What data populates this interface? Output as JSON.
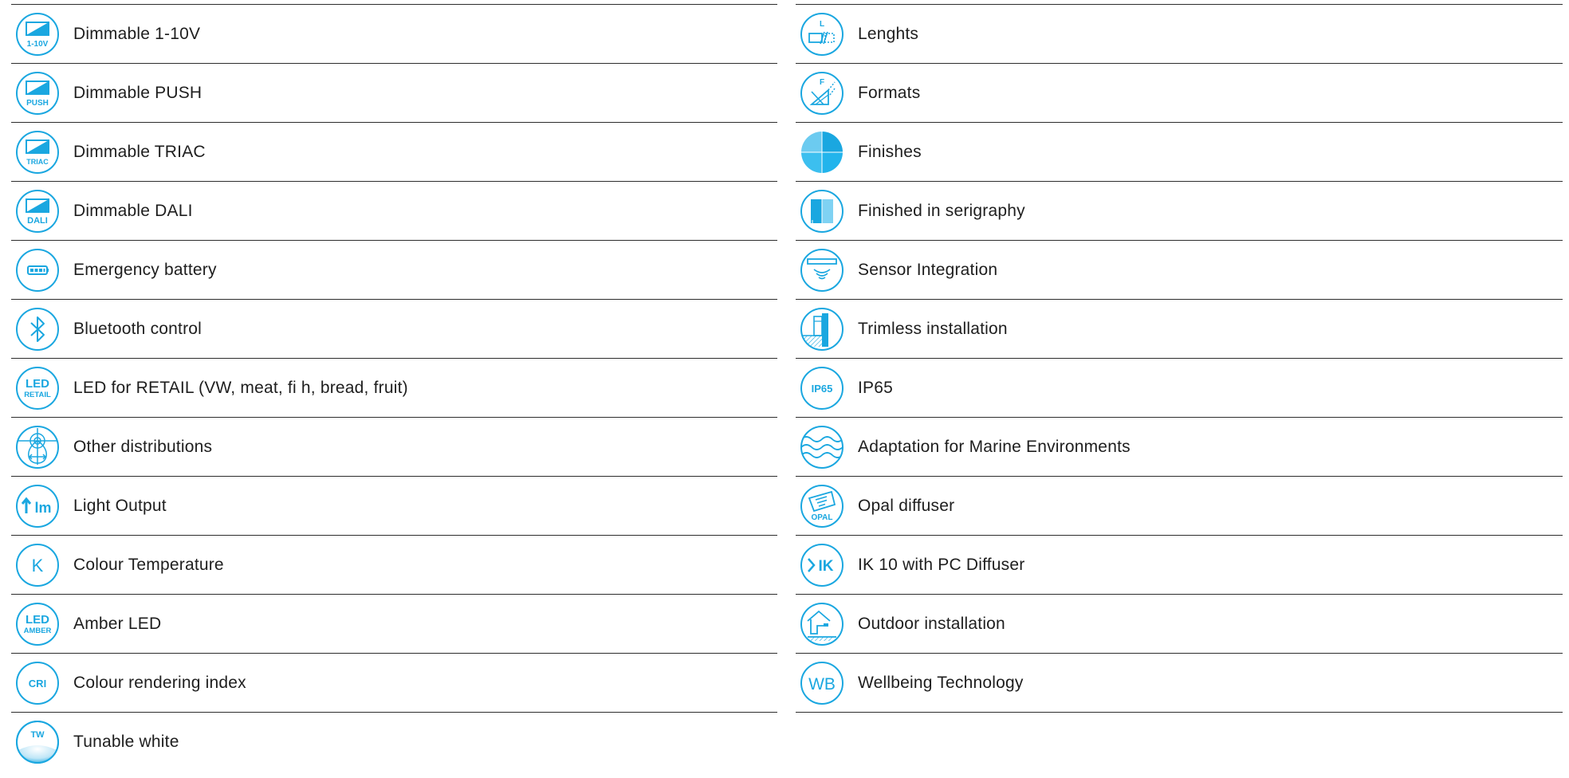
{
  "colors": {
    "accent": "#1aa7e0",
    "rule": "#2c2c2c",
    "text": "#1e1e1e"
  },
  "left": [
    {
      "label": "Dimmable 1-10V",
      "icon": "dimmable-1-10v-icon",
      "icon_text": "1-10V"
    },
    {
      "label": "Dimmable PUSH",
      "icon": "dimmable-push-icon",
      "icon_text": "PUSH"
    },
    {
      "label": "Dimmable TRIAC",
      "icon": "dimmable-triac-icon",
      "icon_text": "TRIAC"
    },
    {
      "label": "Dimmable DALI",
      "icon": "dimmable-dali-icon",
      "icon_text": "DALI"
    },
    {
      "label": "Emergency battery",
      "icon": "battery-icon"
    },
    {
      "label": "Bluetooth control",
      "icon": "bluetooth-icon"
    },
    {
      "label": "LED for RETAIL (VW, meat, fi  h, bread, fruit)",
      "icon": "led-retail-icon",
      "icon_text": "LED",
      "icon_text2": "RETAIL"
    },
    {
      "label": "Other distributions",
      "icon": "distributions-icon"
    },
    {
      "label": "Light Output",
      "icon": "light-output-icon",
      "icon_text": "lm"
    },
    {
      "label": "Colour Temperature",
      "icon": "colour-temperature-icon",
      "icon_text": "K"
    },
    {
      "label": "Amber LED",
      "icon": "amber-led-icon",
      "icon_text": "LED",
      "icon_text2": "AMBER"
    },
    {
      "label": "Colour rendering index",
      "icon": "cri-icon",
      "icon_text": "CRI"
    },
    {
      "label": "Tunable white",
      "icon": "tunable-white-icon",
      "icon_text": "TW"
    }
  ],
  "right": [
    {
      "label": "Lenghts",
      "icon": "lengths-icon",
      "icon_text": "L"
    },
    {
      "label": "Formats",
      "icon": "formats-icon",
      "icon_text": "F"
    },
    {
      "label": "Finishes",
      "icon": "finishes-icon"
    },
    {
      "label": "Finished in serigraphy",
      "icon": "serigraphy-icon"
    },
    {
      "label": "Sensor Integration",
      "icon": "sensor-icon"
    },
    {
      "label": "Trimless installation",
      "icon": "trimless-icon"
    },
    {
      "label": "IP65",
      "icon": "ip65-icon",
      "icon_text": "IP65"
    },
    {
      "label": "Adaptation for Marine Environments",
      "icon": "marine-waves-icon"
    },
    {
      "label": "Opal diffuser",
      "icon": "opal-diffuser-icon",
      "icon_text": "OPAL"
    },
    {
      "label": "IK 10 with PC Diffuser",
      "icon": "ik10-icon",
      "icon_text": "IK"
    },
    {
      "label": "Outdoor installation",
      "icon": "outdoor-icon"
    },
    {
      "label": "Wellbeing Technology",
      "icon": "wellbeing-icon",
      "icon_text": "WB"
    }
  ]
}
